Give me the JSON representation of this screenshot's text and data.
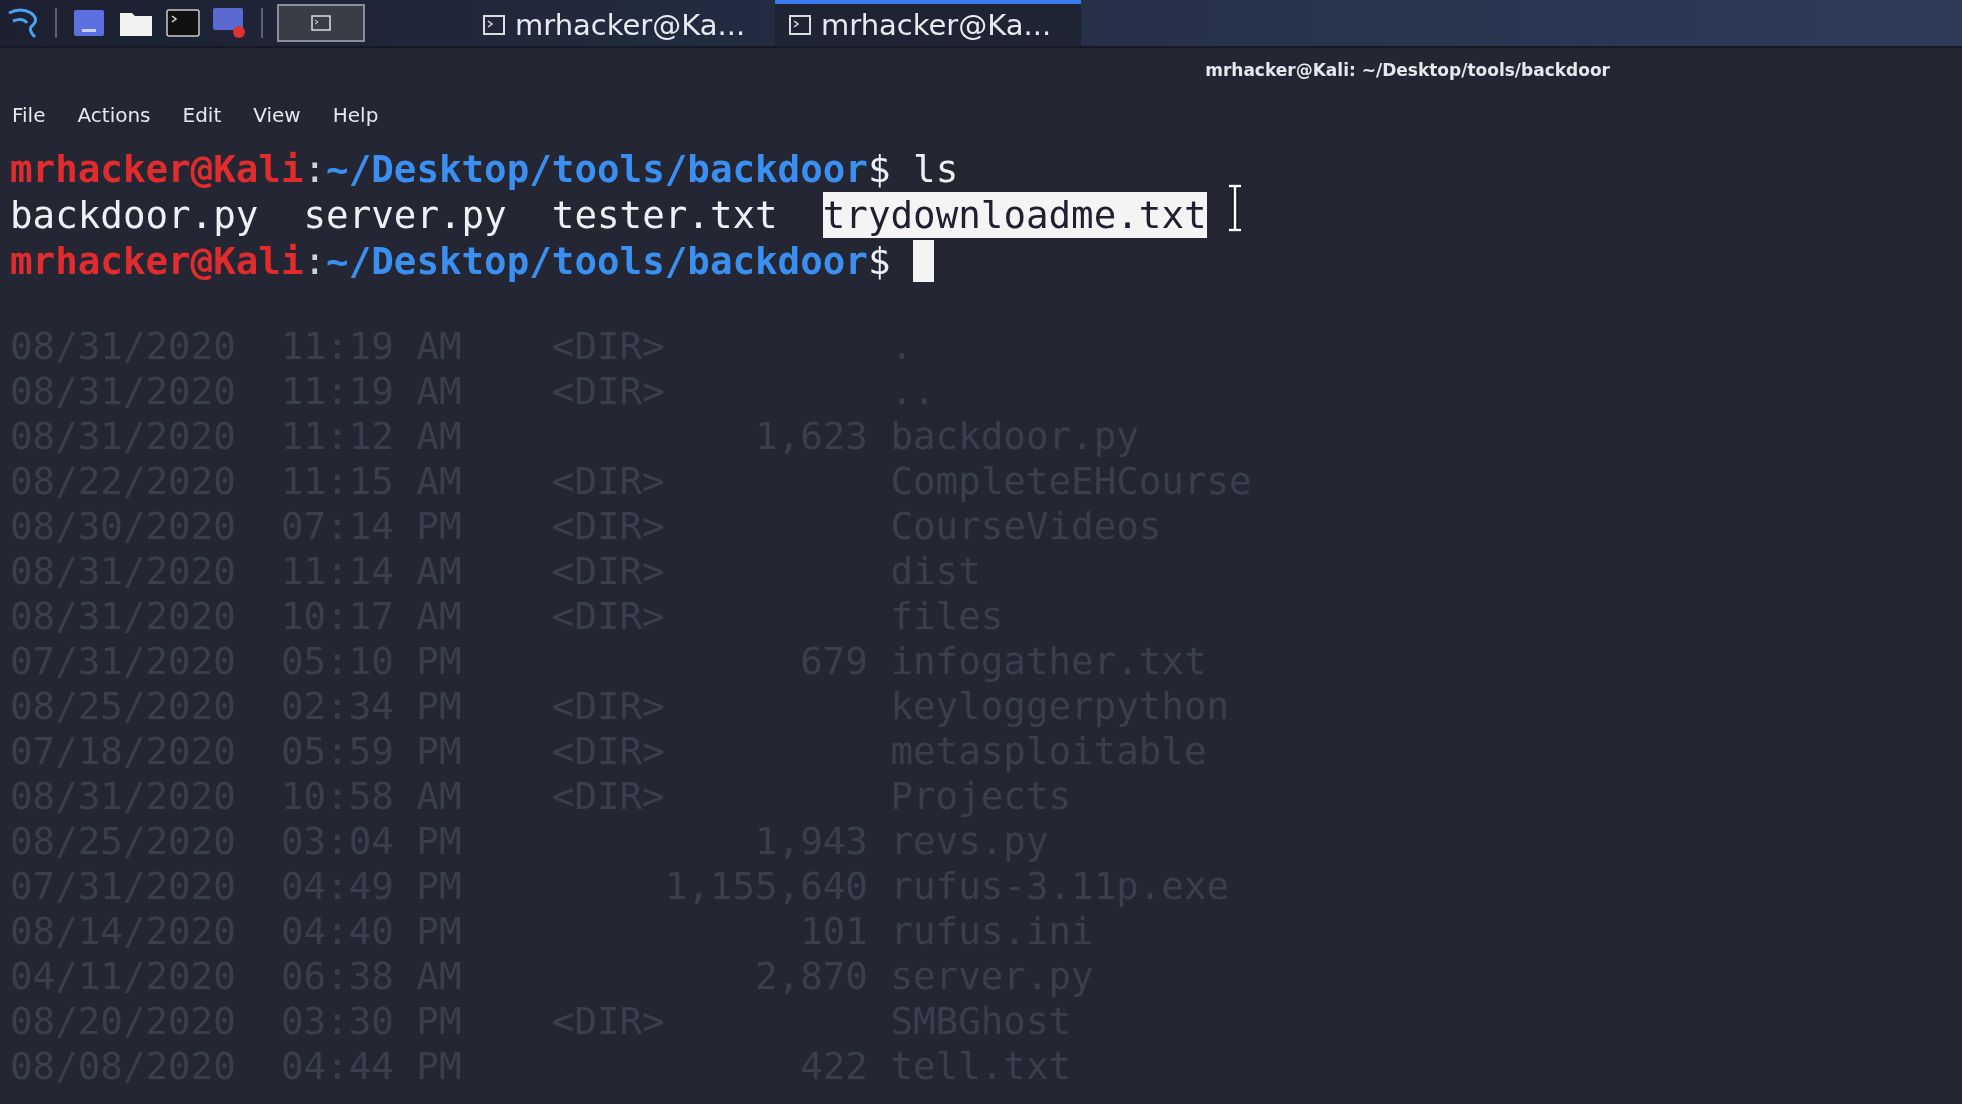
{
  "taskbar": {
    "launchers": [
      {
        "kind": "logo"
      },
      {
        "kind": "window"
      },
      {
        "kind": "folder"
      },
      {
        "kind": "terminal"
      },
      {
        "kind": "recorder"
      }
    ],
    "workspace": {
      "selected": true
    },
    "windows": [
      {
        "label": "mrhacker@Ka...",
        "selected": false
      },
      {
        "label": "mrhacker@Ka...",
        "selected": true
      }
    ]
  },
  "window": {
    "title": "mrhacker@Kali: ~/Desktop/tools/backdoor"
  },
  "menu": [
    "File",
    "Actions",
    "Edit",
    "View",
    "Help"
  ],
  "terminal": {
    "lines": [
      {
        "kind": "prompt",
        "user": "mrhacker@Kali",
        "sep": ":",
        "path": "~/Desktop/tools/backdoor",
        "dollar": "$",
        "command": "ls"
      },
      {
        "kind": "output",
        "files": [
          {
            "text": "backdoor.py",
            "selected": false
          },
          {
            "text": "server.py",
            "selected": false
          },
          {
            "text": "tester.txt",
            "selected": false
          },
          {
            "text": "trydownloadme.txt",
            "selected": true
          }
        ]
      },
      {
        "kind": "prompt",
        "user": "mrhacker@Kali",
        "sep": ":",
        "path": "~/Desktop/tools/backdoor",
        "dollar": "$",
        "cursor": true
      }
    ],
    "faded_listing": [
      {
        "date": "08/31/2020",
        "time": "11:19 AM",
        "dir": "<DIR>",
        "name": "."
      },
      {
        "date": "08/31/2020",
        "time": "11:19 AM",
        "dir": "<DIR>",
        "name": ".."
      },
      {
        "date": "08/31/2020",
        "time": "11:12 AM",
        "size": "1,623",
        "name": "backdoor.py"
      },
      {
        "date": "08/22/2020",
        "time": "11:15 AM",
        "dir": "<DIR>",
        "name": "CompleteEHCourse"
      },
      {
        "date": "08/30/2020",
        "time": "07:14 PM",
        "dir": "<DIR>",
        "name": "CourseVideos"
      },
      {
        "date": "08/31/2020",
        "time": "11:14 AM",
        "dir": "<DIR>",
        "name": "dist"
      },
      {
        "date": "08/31/2020",
        "time": "10:17 AM",
        "dir": "<DIR>",
        "name": "files"
      },
      {
        "date": "07/31/2020",
        "time": "05:10 PM",
        "size": "679",
        "name": "infogather.txt"
      },
      {
        "date": "08/25/2020",
        "time": "02:34 PM",
        "dir": "<DIR>",
        "name": "keyloggerpython"
      },
      {
        "date": "07/18/2020",
        "time": "05:59 PM",
        "dir": "<DIR>",
        "name": "metasploitable"
      },
      {
        "date": "08/31/2020",
        "time": "10:58 AM",
        "dir": "<DIR>",
        "name": "Projects"
      },
      {
        "date": "08/25/2020",
        "time": "03:04 PM",
        "size": "1,943",
        "name": "revs.py"
      },
      {
        "date": "07/31/2020",
        "time": "04:49 PM",
        "size": "1,155,640",
        "name": "rufus-3.11p.exe"
      },
      {
        "date": "08/14/2020",
        "time": "04:40 PM",
        "size": "101",
        "name": "rufus.ini"
      },
      {
        "date": "04/11/2020",
        "time": "06:38 AM",
        "size": "2,870",
        "name": "server.py"
      },
      {
        "date": "08/20/2020",
        "time": "03:30 PM",
        "dir": "<DIR>",
        "name": "SMBGhost"
      },
      {
        "date": "08/08/2020",
        "time": "04:44 PM",
        "size": "422",
        "name": "tell.txt"
      }
    ]
  }
}
